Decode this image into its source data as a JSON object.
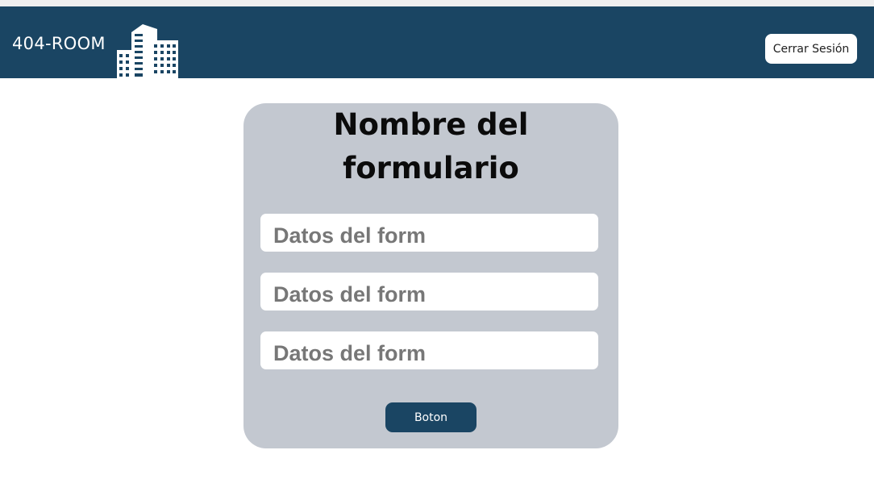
{
  "header": {
    "brand": "404-ROOM",
    "logo_icon": "buildings-icon",
    "logout_label": "Cerrar Sesión",
    "colors": {
      "navbar": "#1a4563",
      "logout_bg": "#ffffff"
    }
  },
  "form": {
    "title": "Nombre del formulario",
    "fields": [
      {
        "placeholder": "Datos del form",
        "value": ""
      },
      {
        "placeholder": "Datos del form",
        "value": ""
      },
      {
        "placeholder": "Datos del form",
        "value": ""
      }
    ],
    "button_label": "Boton",
    "colors": {
      "card_bg": "#c3c8d0",
      "button_bg": "#1a4563"
    }
  }
}
